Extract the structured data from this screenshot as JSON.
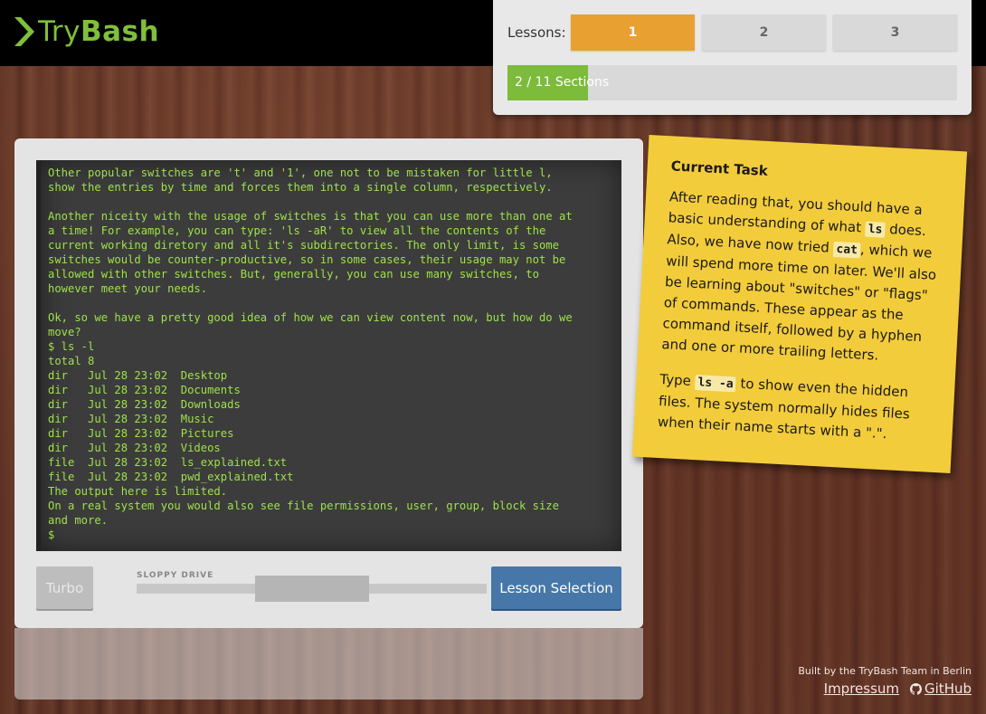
{
  "header": {
    "logo_text_a": "Try",
    "logo_text_b": "Bash"
  },
  "lessons": {
    "label": "Lessons:",
    "items": [
      {
        "label": "1",
        "active": true
      },
      {
        "label": "2",
        "active": false
      },
      {
        "label": "3",
        "active": false
      }
    ],
    "progress": {
      "current": "2",
      "sep": " / ",
      "total": "11",
      "suffix": " Sections",
      "fraction": 0.18
    }
  },
  "terminal": {
    "lines": [
      "Other popular switches are 't' and '1', one not to be mistaken for little l,",
      "show the entries by time and forces them into a single column, respectively.",
      "",
      "Another niceity with the usage of switches is that you can use more than one at",
      "a time! For example, you can type: 'ls -aR' to view all the contents of the",
      "current working diretory and all it's subdirectories. The only limit, is some",
      "switches would be counter-productive, so in some cases, their usage may not be",
      "allowed with other switches. But, generally, you can use many switches, to",
      "however meet your needs.",
      "",
      "Ok, so we have a pretty good idea of how we can view content now, but how do we",
      "move?",
      "$ ls -l",
      "total 8",
      "dir   Jul 28 23:02  Desktop",
      "dir   Jul 28 23:02  Documents",
      "dir   Jul 28 23:02  Downloads",
      "dir   Jul 28 23:02  Music",
      "dir   Jul 28 23:02  Pictures",
      "dir   Jul 28 23:02  Videos",
      "file  Jul 28 23:02  ls_explained.txt",
      "file  Jul 28 23:02  pwd_explained.txt",
      "The output here is limited.",
      "On a real system you would also see file permissions, user, group, block size",
      "and more.",
      "$"
    ]
  },
  "controls": {
    "turbo_label": "Turbo",
    "sloppy_label": "SLOPPY DRIVE",
    "lesson_selection_label": "Lesson Selection"
  },
  "task": {
    "title": "Current Task",
    "p1_a": "After reading that, you should have a basic understanding of what ",
    "p1_code1": "ls",
    "p1_b": " does. Also, we have now tried ",
    "p1_code2": "cat",
    "p1_c": ", which we will spend more time on later. We'll also be learning about \"switches\" or \"flags\" of commands. These appear as the command itself, followed by a hyphen and one or more trailing letters.",
    "p2_a": "Type ",
    "p2_code": "ls -a",
    "p2_b": " to show even the hidden files. The system normally hides files when their name starts with a \".\"."
  },
  "footer": {
    "built_by": "Built by the TryBash Team in Berlin",
    "impressum": "Impressum",
    "github": "GitHub"
  },
  "colors": {
    "accent_green": "#7dbb3a",
    "lesson_active": "#e8a030",
    "note_yellow": "#f3cc3b",
    "button_blue": "#4677a8"
  }
}
